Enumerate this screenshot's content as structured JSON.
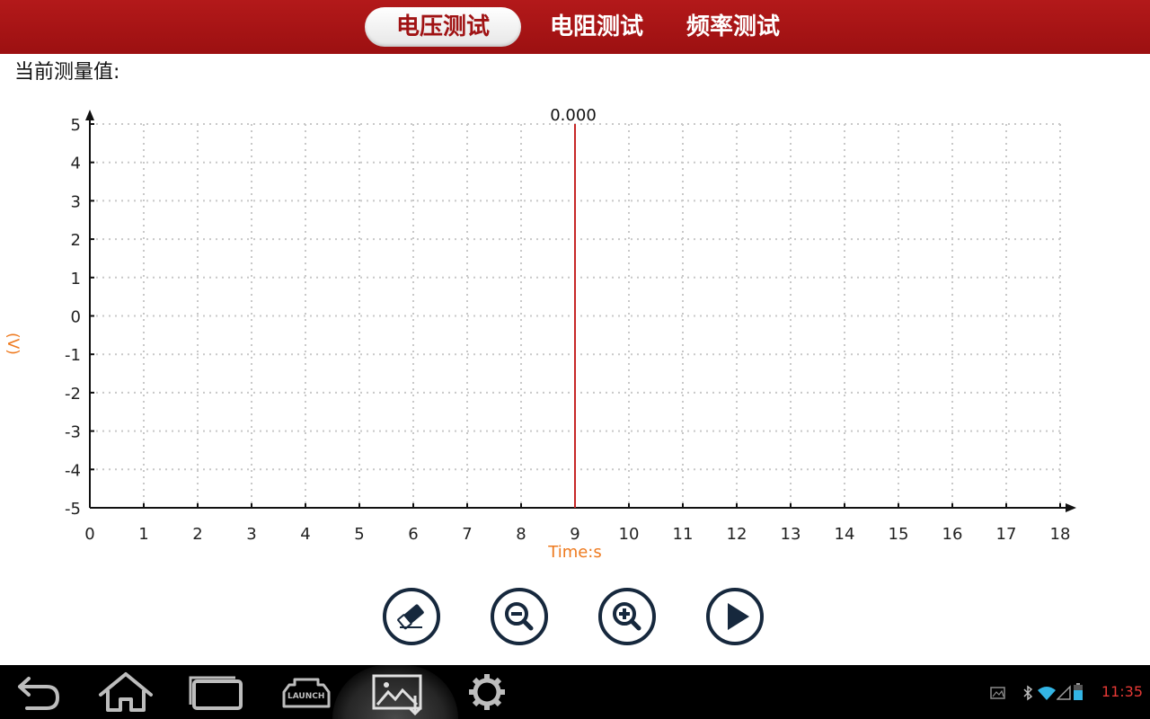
{
  "tabs": [
    {
      "label": "电压测试",
      "active": true
    },
    {
      "label": "电阻测试",
      "active": false
    },
    {
      "label": "频率测试",
      "active": false
    }
  ],
  "current_value_label": "当前测量值:",
  "chart_data": {
    "type": "line",
    "xlabel": "Time:s",
    "ylabel": "(V)",
    "xlim": [
      0,
      18
    ],
    "ylim": [
      -5,
      5
    ],
    "x_ticks": [
      0,
      1,
      2,
      3,
      4,
      5,
      6,
      7,
      8,
      9,
      10,
      11,
      12,
      13,
      14,
      15,
      16,
      17,
      18
    ],
    "y_ticks": [
      5,
      4,
      3,
      2,
      1,
      0,
      -1,
      -2,
      -3,
      -4,
      -5
    ],
    "grid": true,
    "cursor": {
      "x": 9,
      "label": "0.000",
      "color": "#c62828"
    },
    "axis_label_color": "#ee7a1f"
  },
  "controls": {
    "clear": "eraser-icon",
    "zoom_out": "zoom-out-icon",
    "zoom_in": "zoom-in-icon",
    "play": "play-icon"
  },
  "statusbar": {
    "launch_label": "LAUNCH",
    "clock": "11:35"
  }
}
